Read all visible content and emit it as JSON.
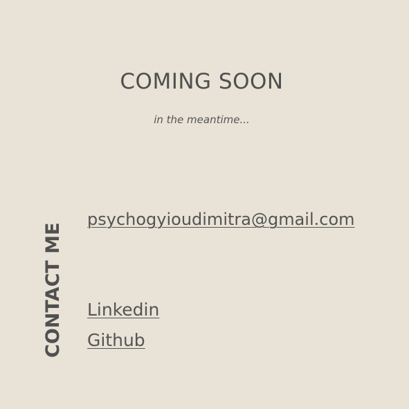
{
  "heading": {
    "title": "COMING SOON",
    "subtitle": "in the meantime..."
  },
  "contact": {
    "label": "CONTACT ME",
    "email": "psychogyioudimitra@gmail.com",
    "links": {
      "linkedin": "Linkedin",
      "github": "Github"
    }
  },
  "colors": {
    "background": "#e8e3d6",
    "text": "#545454"
  }
}
